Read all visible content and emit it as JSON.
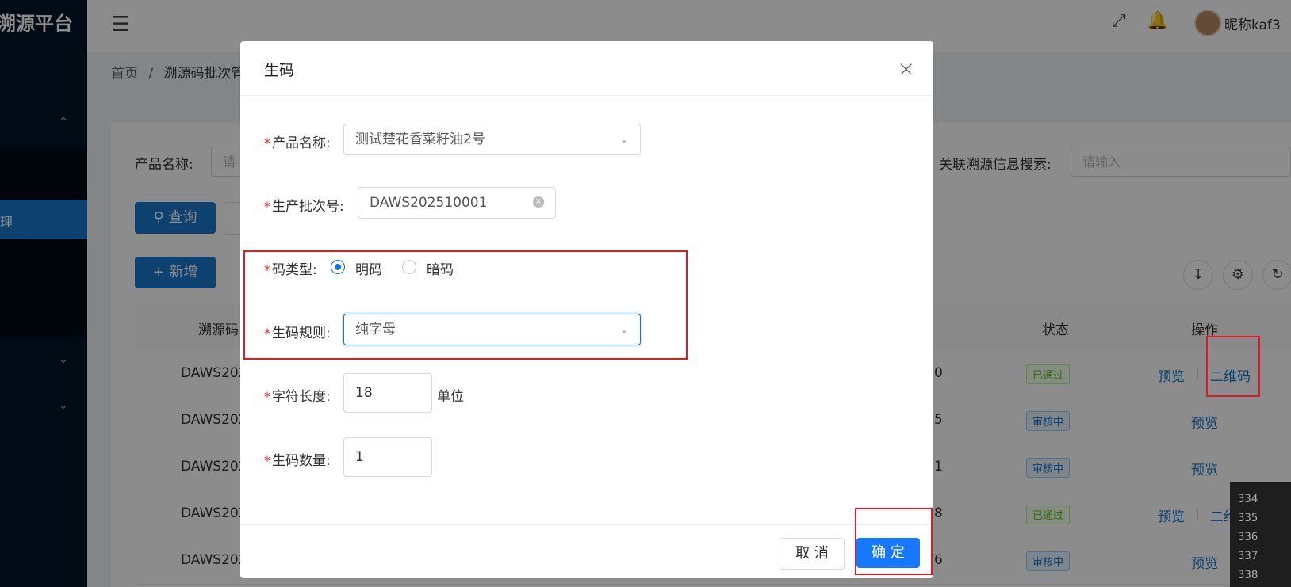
{
  "app": {
    "title": "溯源平台",
    "nickname": "昵称kaf3"
  },
  "header": {
    "menu_icon": "menu-fold-icon",
    "fullscreen_icon": "fullscreen-icon",
    "bell_icon": "bell-icon"
  },
  "sidebar": {
    "active_label": "理"
  },
  "breadcrumb": {
    "home": "首页",
    "sep": "/",
    "current": "溯源码批次管"
  },
  "search": {
    "product_label": "产品名称:",
    "product_placeholder": "请",
    "related_label": "关联溯源信息搜索:",
    "related_placeholder": "请输入",
    "query_label": "查询",
    "add_label": "新增"
  },
  "table": {
    "headers": {
      "code": "溯源码",
      "status": "状态",
      "ops": "操作"
    },
    "rows": [
      {
        "code": "DAWS202",
        "num": "0",
        "status": "已通过",
        "ops": [
          "预览",
          "二维码"
        ]
      },
      {
        "code": "DAWS202",
        "num": "5",
        "status": "审核中",
        "ops": [
          "预览"
        ]
      },
      {
        "code": "DAWS202",
        "num": "1",
        "status": "审核中",
        "ops": [
          "预览"
        ]
      },
      {
        "code": "DAWS202",
        "num": "8",
        "status": "已通过",
        "ops": [
          "预览",
          "二维"
        ]
      },
      {
        "code": "DAWS202",
        "num": "6",
        "status": "审核中",
        "ops": [
          "预览"
        ]
      }
    ]
  },
  "modal": {
    "title": "生码",
    "required_mark": "*",
    "product_label": "产品名称:",
    "product_value": "测试楚花香菜籽油2号",
    "batch_label": "生产批次号:",
    "batch_value": "DAWS202510001",
    "code_type_label": "码类型:",
    "code_type_options": [
      "明码",
      "暗码"
    ],
    "code_type_selected": "明码",
    "rule_label": "生码规则:",
    "rule_value": "纯字母",
    "length_label": "字符长度:",
    "length_value": "18",
    "length_unit": "单位",
    "count_label": "生码数量:",
    "count_value": "1",
    "cancel_label": "取 消",
    "ok_label": "确 定"
  },
  "code_panel": {
    "lines": [
      "334",
      "335",
      "336",
      "337",
      "338"
    ]
  },
  "colors": {
    "primary": "#1677cc",
    "highlight": "#e21b22",
    "sidebar": "#001529"
  }
}
